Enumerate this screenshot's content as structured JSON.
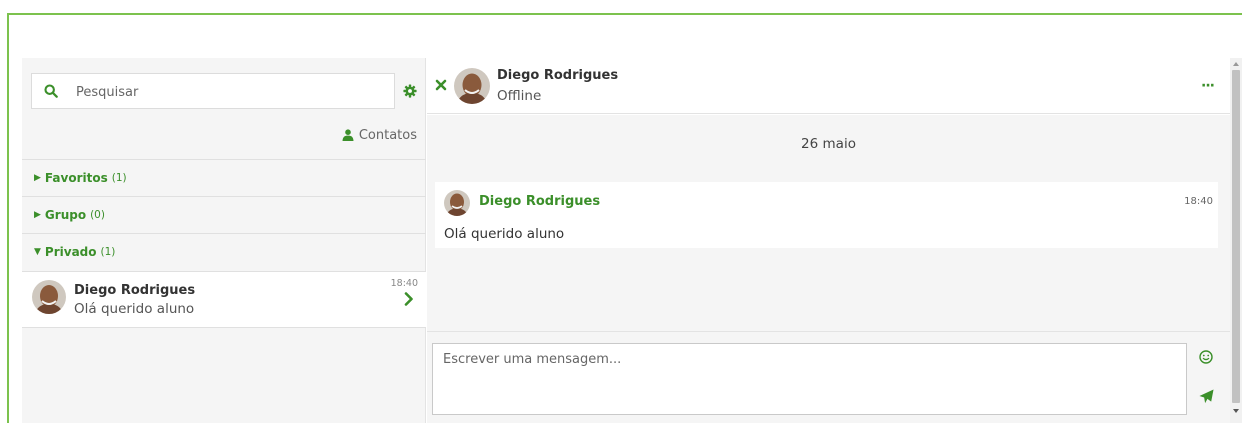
{
  "search": {
    "placeholder": "Pesquisar"
  },
  "contacts_label": "Contatos",
  "sections": [
    {
      "label": "Favoritos",
      "count": "(1)",
      "expanded": false
    },
    {
      "label": "Grupo",
      "count": "(0)",
      "expanded": false
    },
    {
      "label": "Privado",
      "count": "(1)",
      "expanded": true
    }
  ],
  "conversation": {
    "name": "Diego Rodrigues",
    "preview": "Olá querido aluno",
    "time": "18:40"
  },
  "chat_header": {
    "name": "Diego Rodrigues",
    "status": "Offline",
    "more_label": "···"
  },
  "date_separator": "26 maio",
  "message": {
    "sender": "Diego Rodrigues",
    "time": "18:40",
    "text": "Olá querido aluno"
  },
  "composer": {
    "placeholder": "Escrever uma mensagem..."
  },
  "icons": {
    "search": "search-icon",
    "settings": "gear-icon",
    "contacts": "user-icon",
    "close": "close-icon",
    "chevron": "chevron-right-icon",
    "emoji": "smile-icon",
    "send": "send-icon"
  },
  "colors": {
    "accent": "#3b8f2a",
    "frame": "#7cc24e",
    "panel_bg": "#f5f5f5"
  }
}
